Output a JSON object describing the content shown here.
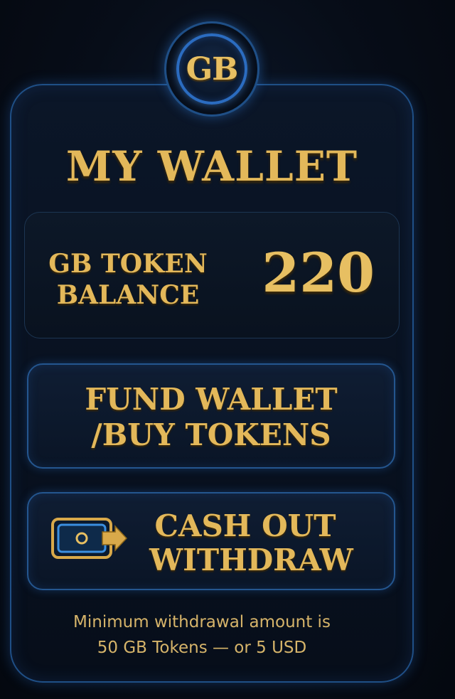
{
  "logo": {
    "text": "GB"
  },
  "wallet": {
    "title": "MY WALLET",
    "balance_label_line1": "GB TOKEN",
    "balance_label_line2": "BALANCE",
    "balance_value": "220"
  },
  "buttons": {
    "fund_line1": "FUND WALLET",
    "fund_line2": "/BUY TOKENS",
    "cash_line1": "CASH OUT",
    "cash_line2": "WITHDRAW",
    "cash_icon": "wallet-arrow-icon"
  },
  "note": {
    "line1": "Minimum withdrawal amount is",
    "line2": "50 GB Tokens  — or 5 USD"
  },
  "colors": {
    "gold": "#e3b85a",
    "border_blue": "#24568f",
    "background": "#070d18"
  }
}
